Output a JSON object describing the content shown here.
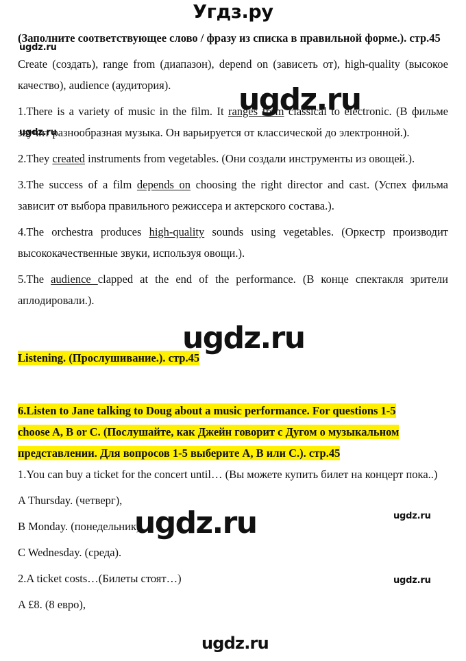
{
  "brand": {
    "top_watermark": "Угдз.ру",
    "watermark_text": "ugdz.ru"
  },
  "page_number_label": "стр.45",
  "exercise_heading": {
    "line1": "(Заполните соответствующее слово / фразу из списка в правильной",
    "line2": "форме.). стр.45"
  },
  "word_bank": "Create (создать), range from (диапазон), depend on (зависеть от), high-quality (высокое качество), audience (аудитория).",
  "answers": [
    {
      "number": "1.",
      "pre": "There is a variety of music in the film. It ",
      "underlined": "ranges from",
      "post": " classical to electronic. (В фильме звучит разнообразная музыка. Он варьируется от классической до электронной.)."
    },
    {
      "number": "2.",
      "pre": "They ",
      "underlined": "created",
      "post": " instruments from vegetables. (Они создали инструменты из овощей.)."
    },
    {
      "number": "3.",
      "pre": "The success of a film ",
      "underlined": "depends on",
      "post": " choosing the right director and cast. (Успех фильма зависит от выбора правильного режиссера и актерского состава.)."
    },
    {
      "number": "4.",
      "pre": "The orchestra produces ",
      "underlined": "high-quality",
      "post": " sounds using vegetables. (Оркестр производит высококачественные звуки, используя овощи.)."
    },
    {
      "number": "5.",
      "pre": "The ",
      "underlined": "audience ",
      "post": "clapped at the end of the performance. (В конце спектакля зрители аплодировали.)."
    }
  ],
  "section_listening": {
    "highlighted_title": "Listening. (Прослушивание.). стр.45"
  },
  "task6": {
    "line1": "6.Listen to Jane talking to Doug about a music performance. For questions 1-5",
    "line2": "choose A, B or C. (Послушайте, как Джейн говорит с Дугом о музыкальном",
    "line3": "представлении. Для вопросов 1-5 выберите A, B или C.). стр.45"
  },
  "questions": [
    {
      "number": "1.",
      "text": "You can buy a ticket for the concert until… (Вы можете купить билет на концерт пока..)",
      "options": [
        "A Thursday. (четверг),",
        "B Monday. (понедельник),",
        "C Wednesday. (среда)."
      ]
    },
    {
      "number": "2.",
      "text": "A ticket costs…(Билеты стоят…)",
      "options": [
        "A £8. (8 евро),"
      ]
    }
  ],
  "colors": {
    "highlight": "#ffef00",
    "text": "#111111",
    "background": "#ffffff"
  }
}
